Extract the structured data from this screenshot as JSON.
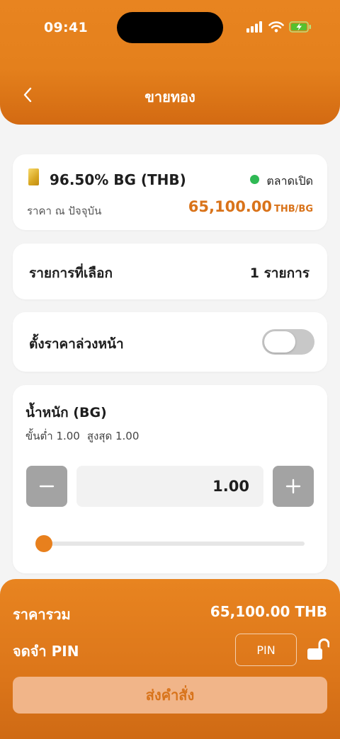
{
  "status_bar": {
    "time": "09:41"
  },
  "header": {
    "title": "ขายทอง"
  },
  "product": {
    "name": "96.50% BG (THB)",
    "market_status": "ตลาดเปิด",
    "market_color": "#2fb954",
    "price_label": "ราคา ณ ปัจจุบัน",
    "price": "65,100.00",
    "price_unit": "THB/BG"
  },
  "selection": {
    "label": "รายการที่เลือก",
    "value": "1 รายการ"
  },
  "preset_price": {
    "label": "ตั้งราคาล่วงหน้า",
    "enabled": false
  },
  "weight": {
    "title": "น้ำหนัก (BG)",
    "min_text": "ขั้นต่ำ 1.00",
    "max_text": "สูงสุด 1.00",
    "value": "1.00",
    "slider_fraction": 0
  },
  "summary": {
    "total_label": "ราคารวม",
    "total_value": "65,100.00 THB",
    "remember_pin_label": "จดจำ PIN",
    "pin_button": "PIN",
    "submit_label": "ส่งคำสั่ง"
  },
  "colors": {
    "accent": "#e4801c",
    "price": "#d9731a",
    "submit_bg": "#f1b589"
  }
}
